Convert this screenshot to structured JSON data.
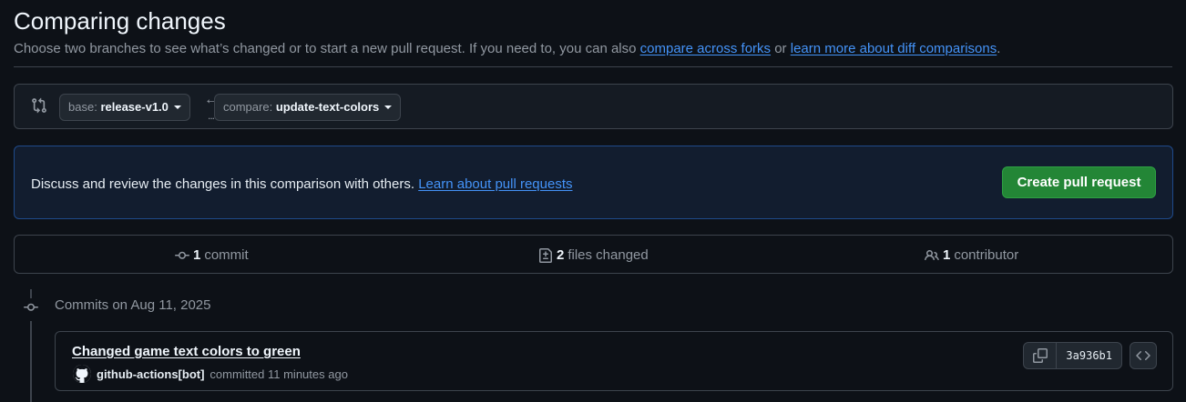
{
  "header": {
    "title": "Comparing changes",
    "subtitle_prefix": "Choose two branches to see what’s changed or to start a new pull request. If you need to, you can also ",
    "link_forks": "compare across forks",
    "subtitle_mid": " or ",
    "link_diff": "learn more about diff comparisons",
    "subtitle_suffix": "."
  },
  "range": {
    "base_prefix": "base:",
    "base_branch": "release-v1.0",
    "compare_prefix": "compare:",
    "compare_branch": "update-text-colors",
    "arrow": "←",
    "dots": "..."
  },
  "flash": {
    "message": "Discuss and review the changes in this comparison with others.",
    "link": "Learn about pull requests",
    "button": "Create pull request"
  },
  "stats": {
    "commits_count": "1",
    "commits_label": "commit",
    "files_count": "2",
    "files_label": "files changed",
    "contributors_count": "1",
    "contributors_label": "contributor"
  },
  "commits": {
    "date_heading": "Commits on Aug 11, 2025",
    "items": [
      {
        "title": "Changed game text colors to green",
        "author": "github-actions[bot]",
        "action": "committed 11 minutes ago",
        "sha": "3a936b1"
      }
    ]
  },
  "colors": {
    "background": "#0d1117",
    "accent_link": "#4493f8",
    "primary_button": "#238636",
    "flash_border": "#1f4a8a"
  }
}
